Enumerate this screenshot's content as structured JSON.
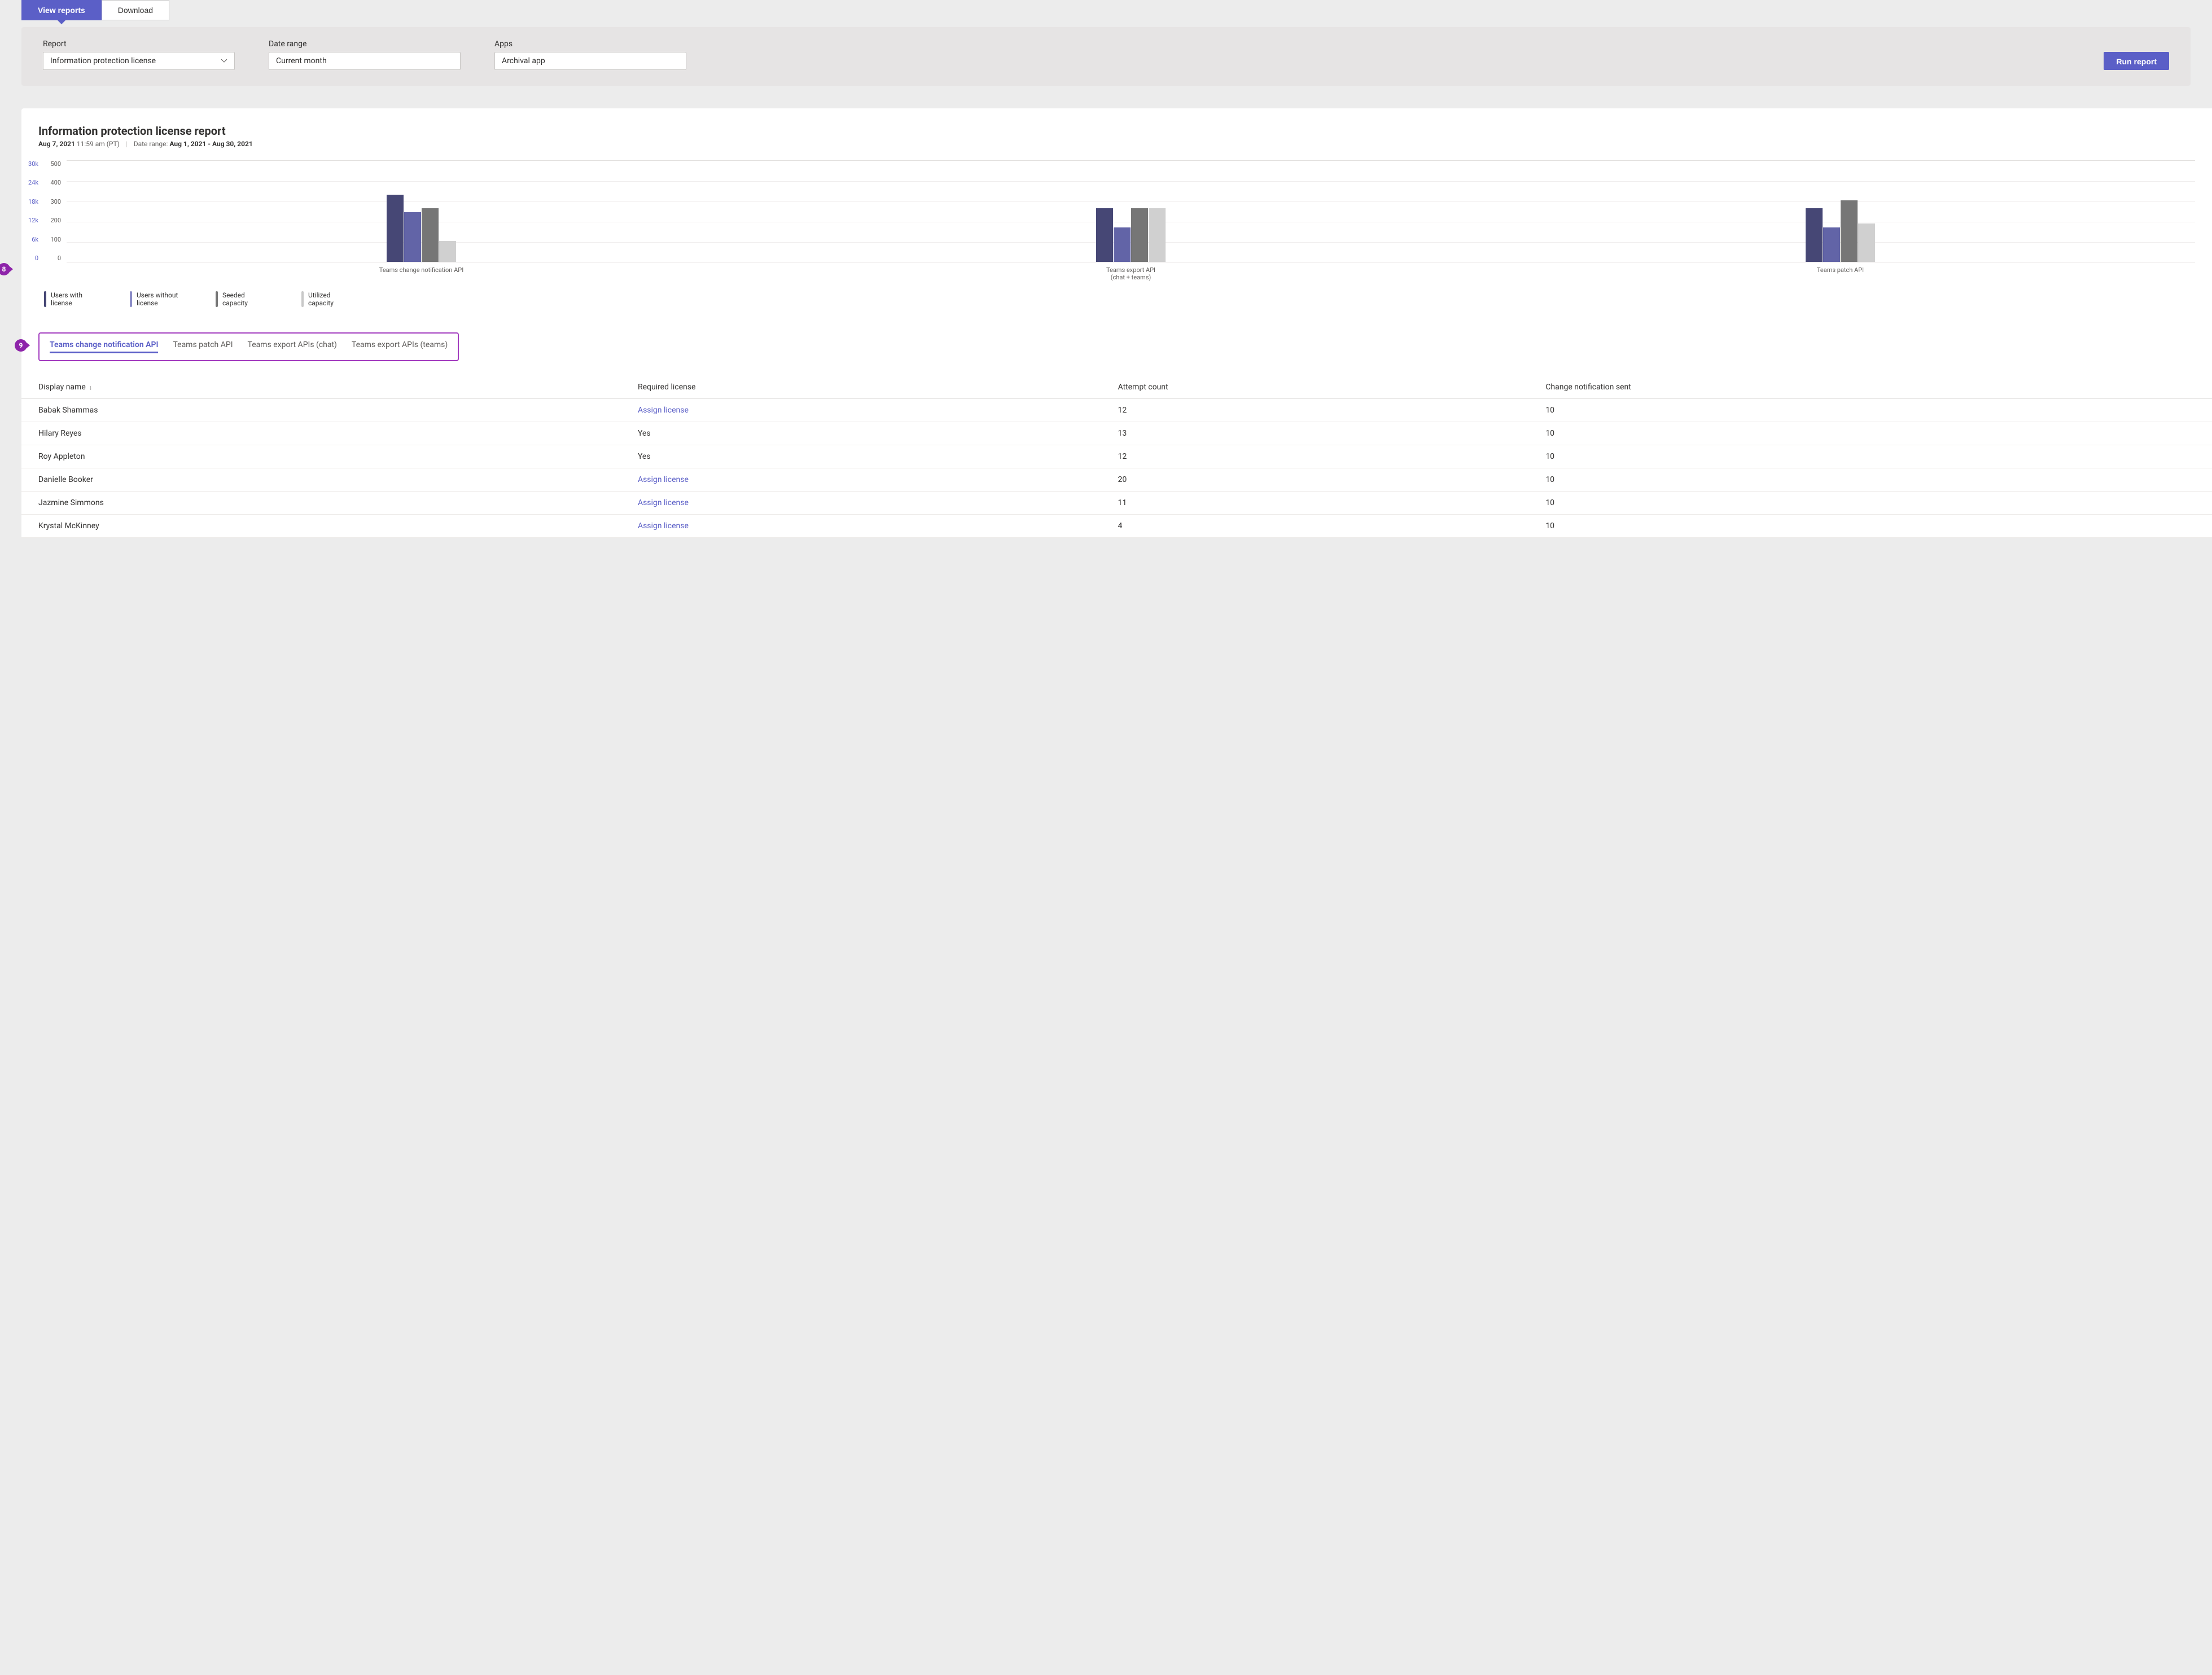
{
  "top_tabs": {
    "view": "View reports",
    "download": "Download"
  },
  "filters": {
    "report_label": "Report",
    "report_value": "Information protection license",
    "date_label": "Date range",
    "date_value": "Current month",
    "apps_label": "Apps",
    "apps_value": "Archival app",
    "run": "Run report"
  },
  "report": {
    "title": "Information protection license report",
    "gen_date": "Aug 7, 2021",
    "gen_time": "11:59 am (PT)",
    "range_prefix": "Date range:",
    "range_value": "Aug 1, 2021 - Aug 30, 2021"
  },
  "callouts": {
    "legend": "8",
    "tabs": "9"
  },
  "chart_data": {
    "type": "bar",
    "y_primary": {
      "label": "",
      "ticks": [
        "30k",
        "24k",
        "18k",
        "12k",
        "6k",
        "0"
      ],
      "max": 30
    },
    "y_secondary": {
      "label": "",
      "ticks": [
        "500",
        "400",
        "300",
        "200",
        "100",
        "0"
      ],
      "max": 500
    },
    "categories": [
      "Teams change notification API",
      "Teams export API\n(chat + teams)",
      "Teams patch API"
    ],
    "series": [
      {
        "name": "Users with license",
        "color": "#464775",
        "values": [
          350,
          280,
          280
        ]
      },
      {
        "name": "Users without license",
        "color": "#6264a7",
        "values": [
          260,
          180,
          180
        ]
      },
      {
        "name": "Seeded capacity",
        "color": "#767676",
        "values": [
          280,
          280,
          320
        ]
      },
      {
        "name": "Utilized capacity",
        "color": "#d0d0d0",
        "values": [
          110,
          280,
          200
        ]
      }
    ],
    "legend": [
      "Users with\nlicense",
      "Users without\nlicense",
      "Seeded\ncapacity",
      "Utilized\ncapacity"
    ]
  },
  "data_tabs": [
    "Teams change notification API",
    "Teams patch API",
    "Teams export APIs (chat)",
    "Teams export APIs (teams)"
  ],
  "table": {
    "headers": [
      "Display name",
      "Required license",
      "Attempt count",
      "Change notification sent"
    ],
    "assign_link": "Assign license",
    "rows": [
      {
        "name": "Babak Shammas",
        "license": null,
        "attempt": "12",
        "sent": "10"
      },
      {
        "name": "Hilary Reyes",
        "license": "Yes",
        "attempt": "13",
        "sent": "10"
      },
      {
        "name": "Roy Appleton",
        "license": "Yes",
        "attempt": "12",
        "sent": "10"
      },
      {
        "name": "Danielle Booker",
        "license": null,
        "attempt": "20",
        "sent": "10"
      },
      {
        "name": "Jazmine Simmons",
        "license": null,
        "attempt": "11",
        "sent": "10"
      },
      {
        "name": "Krystal McKinney",
        "license": null,
        "attempt": "4",
        "sent": "10"
      }
    ]
  }
}
